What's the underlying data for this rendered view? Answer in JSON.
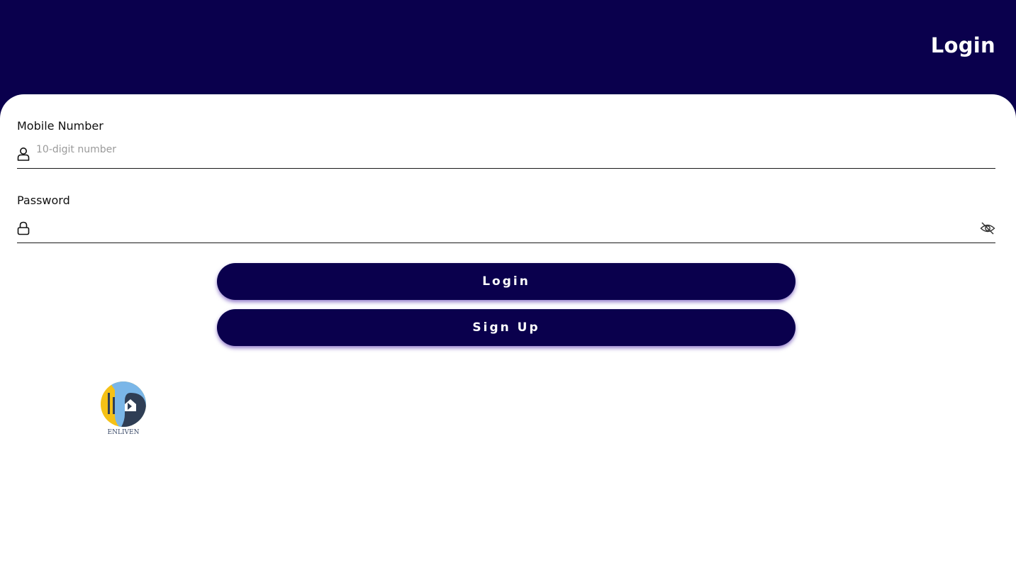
{
  "header": {
    "title": "Login"
  },
  "form": {
    "mobile": {
      "label": "Mobile Number",
      "placeholder": "10-digit number",
      "value": ""
    },
    "password": {
      "label": "Password",
      "placeholder": "",
      "value": ""
    }
  },
  "buttons": {
    "login_label": "Login",
    "signup_label": "Sign Up"
  },
  "logo": {
    "text": "ENLIVEN"
  },
  "icons": {
    "mobile_field": "user-icon",
    "password_field": "lock-icon",
    "password_visibility": "eye-off-icon"
  },
  "colors": {
    "primary": "#0a004d",
    "background": "#ffffff",
    "button_text": "#ffffff",
    "logo_yellow": "#f5c116",
    "logo_blue": "#7ab6e8",
    "logo_dark": "#2f3e55"
  }
}
